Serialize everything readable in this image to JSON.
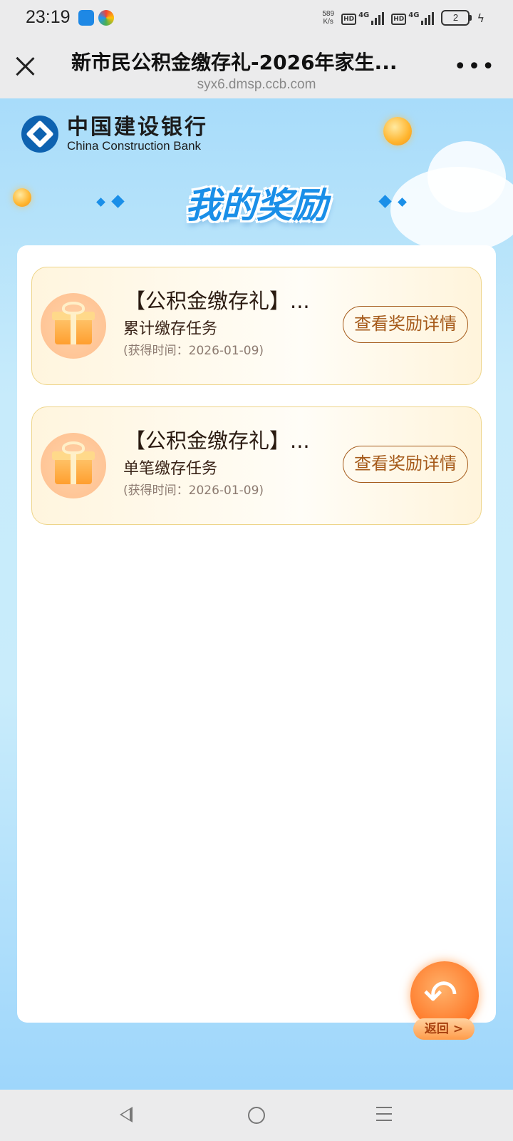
{
  "status_bar": {
    "time": "23:19",
    "net_speed_value": "589",
    "net_speed_unit": "K/s",
    "sim1_hd": "HD",
    "sim1_type": "4G",
    "sim2_hd": "HD",
    "sim2_type": "4G",
    "battery": "2"
  },
  "browser": {
    "title": "新市民公积金缴存礼-2026年家生...",
    "url": "syx6.dmsp.ccb.com",
    "more": "•••"
  },
  "brand": {
    "name_cn": "中国建设银行",
    "name_en": "China Construction Bank"
  },
  "heading": "我的奖励",
  "rewards": [
    {
      "title": "【公积金缴存礼】...",
      "subtitle": "累计缴存任务",
      "time_text": "(获得时间：2026-01-09)",
      "button": "查看奖励详情"
    },
    {
      "title": "【公积金缴存礼】...",
      "subtitle": "单笔缴存任务",
      "time_text": "(获得时间：2026-01-09)",
      "button": "查看奖励详情"
    }
  ],
  "back_button": {
    "label": "返回 >"
  },
  "colors": {
    "accent_blue": "#1a8fe8",
    "button_brown": "#a55a1a",
    "card_border": "#eed58a",
    "brand_blue": "#0e62b0"
  }
}
